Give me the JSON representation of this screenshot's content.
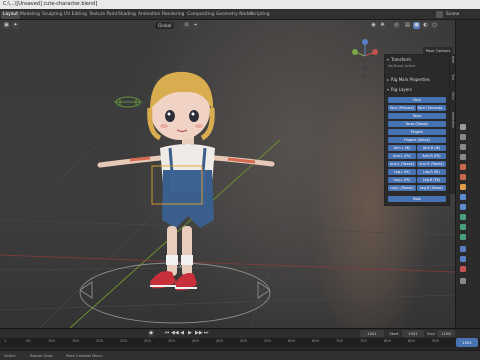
{
  "window": {
    "title": "C:\\...\\[Unsaved] cute-character.blend]"
  },
  "workspace_tabs": [
    {
      "label": "Layout",
      "active": true
    },
    {
      "label": "Modeling",
      "active": false
    },
    {
      "label": "Sculpting",
      "active": false
    },
    {
      "label": "UV Editing",
      "active": false
    },
    {
      "label": "Texture Paint",
      "active": false
    },
    {
      "label": "Shading",
      "active": false
    },
    {
      "label": "Animation",
      "active": false
    },
    {
      "label": "Rendering",
      "active": false
    },
    {
      "label": "Compositing",
      "active": false
    },
    {
      "label": "Geometry Nodes",
      "active": false
    },
    {
      "label": "Scripting",
      "active": false
    }
  ],
  "top_right": {
    "scene_label": "Scene"
  },
  "viewport_header": {
    "transform_orientation": "Global",
    "pose_options": "Pose Options"
  },
  "npanel": {
    "transform_label": "Transform",
    "no_bone_label": "No Bone Active",
    "rig_main_label": "Rig Main Properties",
    "rig_layers_label": "Rig Layers",
    "tabs": [
      "Item",
      "Tool",
      "View",
      "Animation"
    ],
    "rig_buttons": {
      "face": "Face",
      "face_primary": "Face (Primary)",
      "face_secondary": "Face (Seconda...",
      "torso": "Torso",
      "torso_tweak": "Torso (Tweak)",
      "fingers": "Fingers",
      "fingers_detail": "Fingers (Detail)",
      "arm_ik_l": "Arm.L (IK)",
      "arm_ik_r": "Arm.R (IK)",
      "arm_fk_l": "Arm.L (FK)",
      "arm_fk_r": "Arm.R (FK)",
      "arm_tweak_l": "Arm.L (Tweak)",
      "arm_tweak_r": "Arm.R (Tweak)",
      "leg_ik_l": "Leg.L (IK)",
      "leg_ik_r": "Leg.R (IK)",
      "leg_fk_l": "Leg.L (FK)",
      "leg_fk_r": "Leg.R (FK)",
      "leg_tweak_l": "Leg.L (Tweak)",
      "leg_tweak_r": "Leg.R (Tweak)",
      "root": "Root"
    }
  },
  "timeline": {
    "current_frame": "1001",
    "start_label": "Start",
    "start_value": "1001",
    "end_label": "End",
    "end_value": "1100",
    "ruler_labels": [
      "1",
      "50",
      "100",
      "150",
      "200",
      "250",
      "300",
      "350",
      "400",
      "450",
      "500",
      "550",
      "600",
      "650",
      "700",
      "750",
      "800",
      "850",
      "900"
    ],
    "playhead_label": "1001"
  },
  "status_bar": {
    "select_hint": "Select",
    "rotate_hint": "Rotate View",
    "context_hint": "Pose Context Menu"
  },
  "colors": {
    "accent_blue": "#4772b3",
    "background": "#3d3d3d",
    "panel": "#282828"
  }
}
